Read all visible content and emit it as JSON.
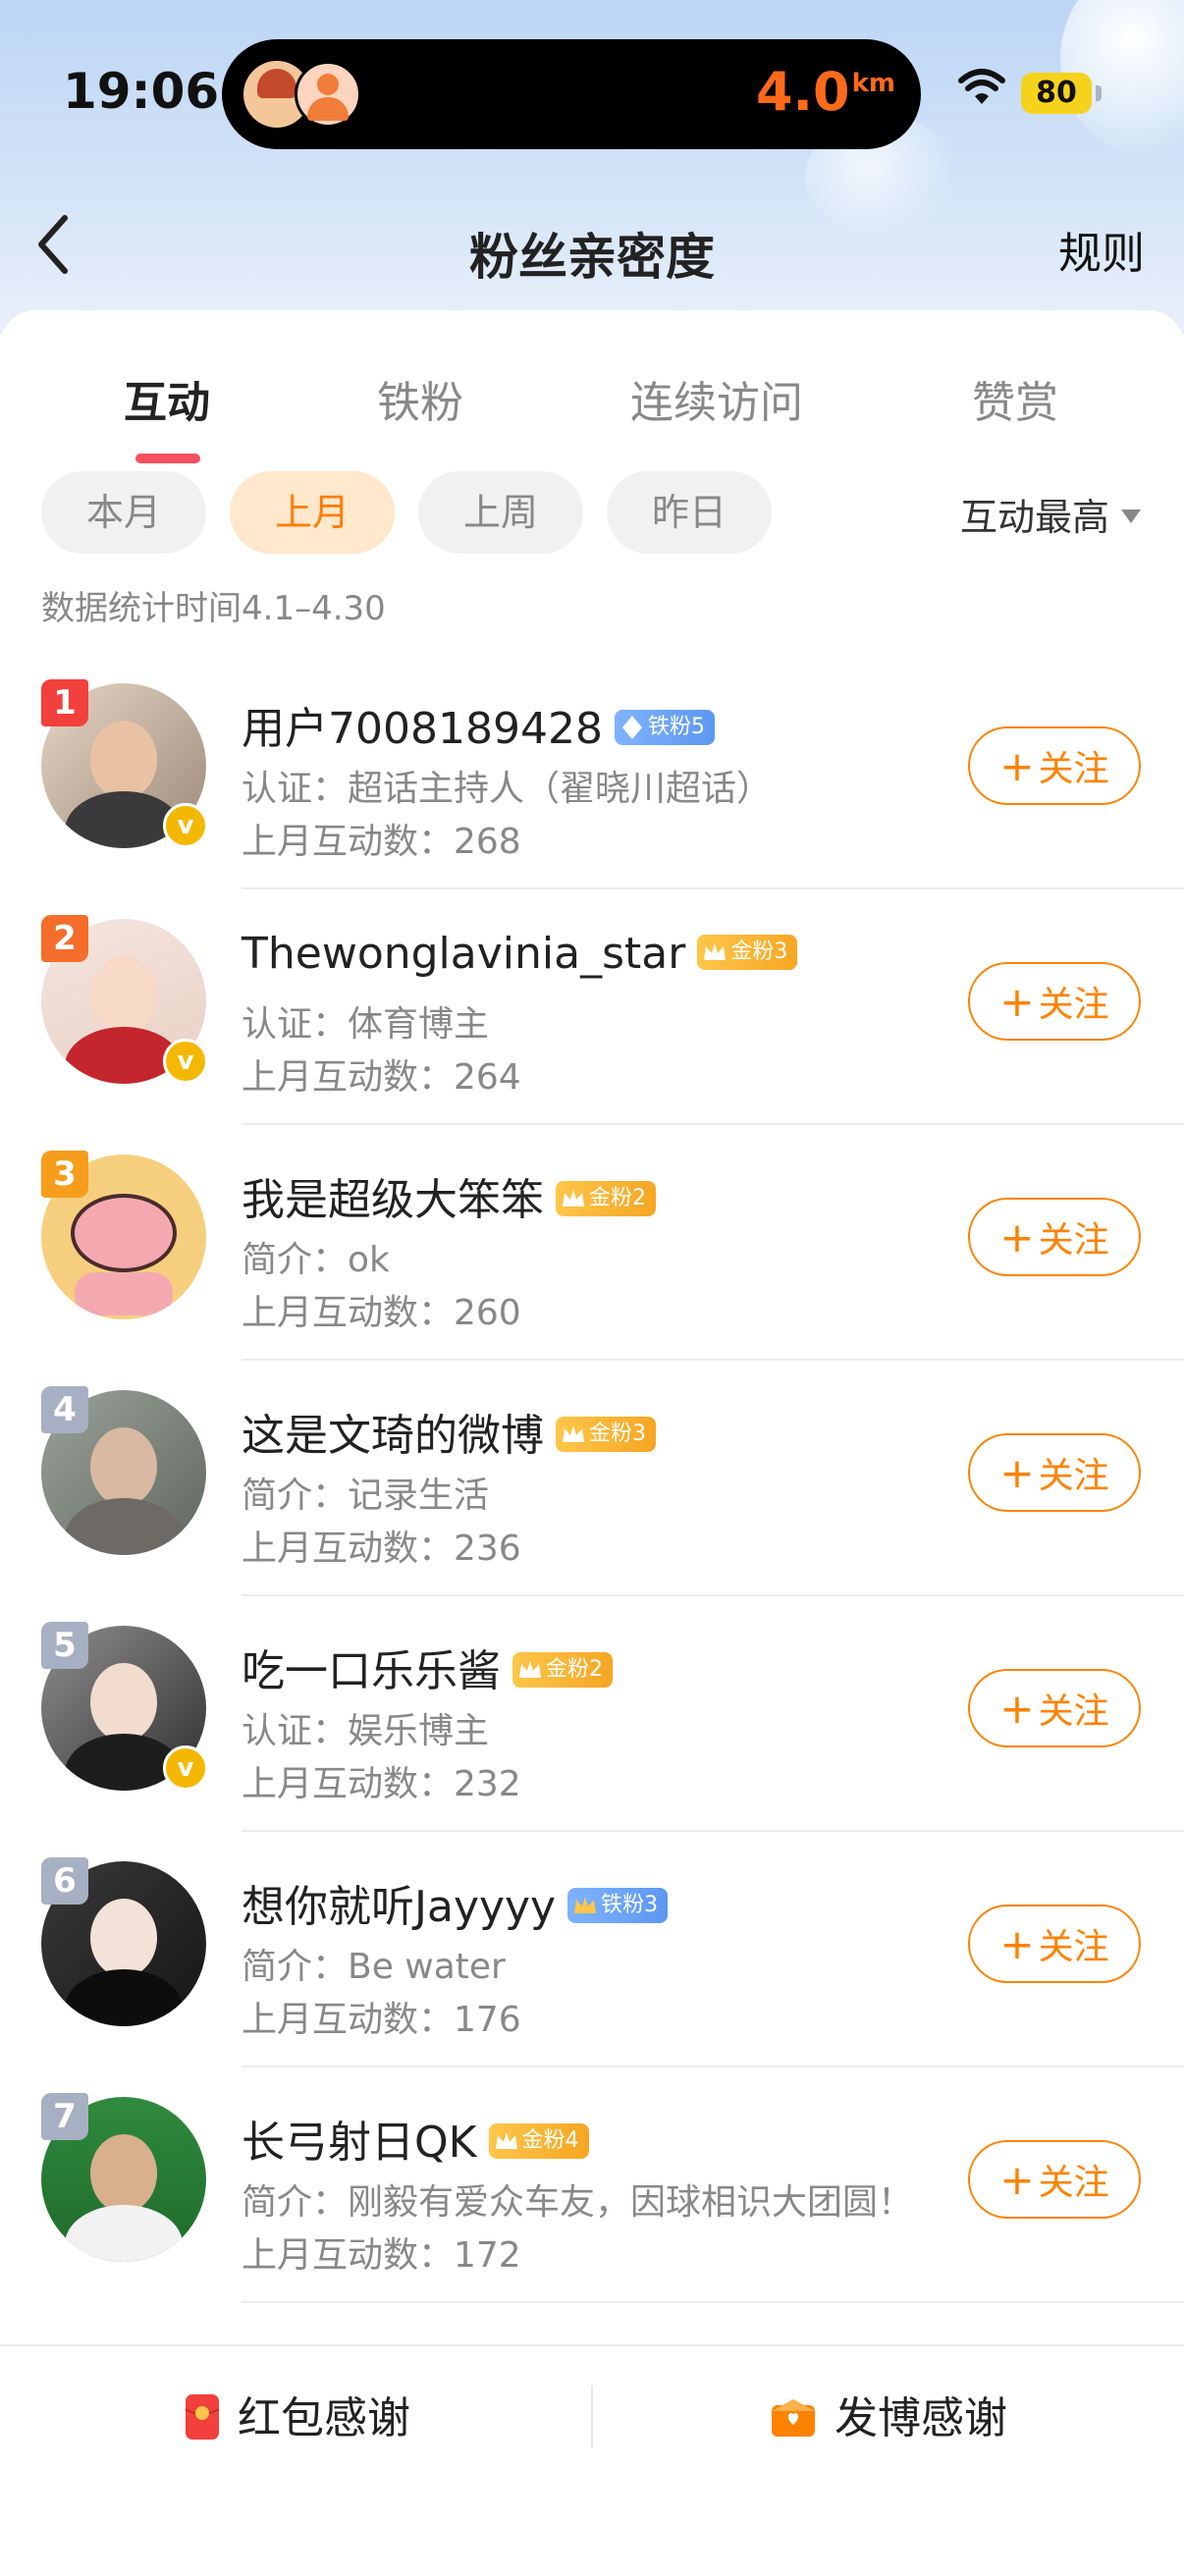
{
  "status_bar": {
    "time": "19:06",
    "distance_value": "4.0",
    "distance_unit": "km",
    "battery": "80"
  },
  "nav": {
    "back_icon": "chevron-left-icon",
    "title": "粉丝亲密度",
    "rules_label": "规则"
  },
  "tabs": [
    {
      "label": "互动",
      "active": true
    },
    {
      "label": "铁粉",
      "active": false
    },
    {
      "label": "连续访问",
      "active": false
    },
    {
      "label": "赞赏",
      "active": false
    }
  ],
  "filters": [
    {
      "label": "本月",
      "active": false
    },
    {
      "label": "上月",
      "active": true
    },
    {
      "label": "上周",
      "active": false
    },
    {
      "label": "昨日",
      "active": false
    }
  ],
  "sort_label": "互动最高",
  "stat_time": "数据统计时间4.1–4.30",
  "follow_label": "关注",
  "fans": [
    {
      "rank": "1",
      "name": "用户7008189428",
      "badge": "铁粉5",
      "badge_type": "iron",
      "sub": "认证：超话主持人（翟晓川超话）",
      "count": "上月互动数：268",
      "verified": true
    },
    {
      "rank": "2",
      "name": "Thewonglavinia_star",
      "badge": "金粉3",
      "badge_type": "gold",
      "sub": "认证：体育博主",
      "count": "上月互动数：264",
      "verified": true
    },
    {
      "rank": "3",
      "name": "我是超级大笨笨",
      "badge": "金粉2",
      "badge_type": "gold",
      "sub": "简介：ok",
      "count": "上月互动数：260",
      "verified": false
    },
    {
      "rank": "4",
      "name": "这是文琦的微博",
      "badge": "金粉3",
      "badge_type": "gold",
      "sub": "简介：记录生活",
      "count": "上月互动数：236",
      "verified": false
    },
    {
      "rank": "5",
      "name": "吃一口乐乐酱",
      "badge": "金粉2",
      "badge_type": "gold",
      "sub": "认证：娱乐博主",
      "count": "上月互动数：232",
      "verified": true
    },
    {
      "rank": "6",
      "name": "想你就听Jayyyy",
      "badge": "铁粉3",
      "badge_type": "iron-crown",
      "sub": "简介：Be water",
      "count": "上月互动数：176",
      "verified": false
    },
    {
      "rank": "7",
      "name": "长弓射日QK",
      "badge": "金粉4",
      "badge_type": "gold",
      "sub": "简介：刚毅有爱众车友，因球相识大团圆！",
      "count": "上月互动数：172",
      "verified": false
    }
  ],
  "bottom": {
    "left_label": "红包感谢",
    "right_label": "发博感谢"
  }
}
